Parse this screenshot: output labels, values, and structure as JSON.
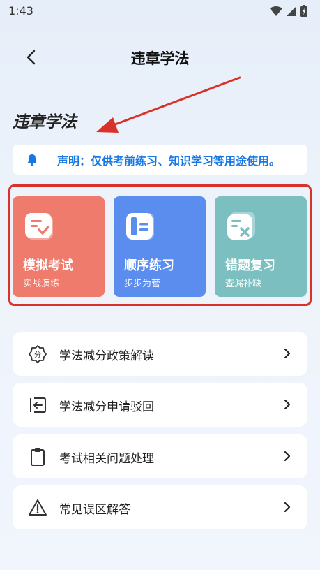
{
  "status_bar": {
    "time": "1:43"
  },
  "nav": {
    "title": "违章学法"
  },
  "section": {
    "title": "违章学法"
  },
  "notice": {
    "text": "声明：仅供考前练习、知识学习等用途使用。"
  },
  "cards": [
    {
      "title": "模拟考试",
      "subtitle": "实战演练",
      "color": "#ef7b6c",
      "icon": "exam-check-icon"
    },
    {
      "title": "顺序练习",
      "subtitle": "步步为营",
      "color": "#5b8def",
      "icon": "sequence-practice-icon"
    },
    {
      "title": "错题复习",
      "subtitle": "查漏补缺",
      "color": "#7bbfc0",
      "icon": "wrong-answer-review-icon"
    }
  ],
  "list": [
    {
      "label": "学法减分政策解读",
      "icon": "points-badge-icon"
    },
    {
      "label": "学法减分申请驳回",
      "icon": "return-arrow-icon"
    },
    {
      "label": "考试相关问题处理",
      "icon": "clipboard-icon"
    },
    {
      "label": "常见误区解答",
      "icon": "warning-triangle-icon"
    }
  ],
  "colors": {
    "notice_text": "#1677e5",
    "annotation": "#d8332a"
  }
}
